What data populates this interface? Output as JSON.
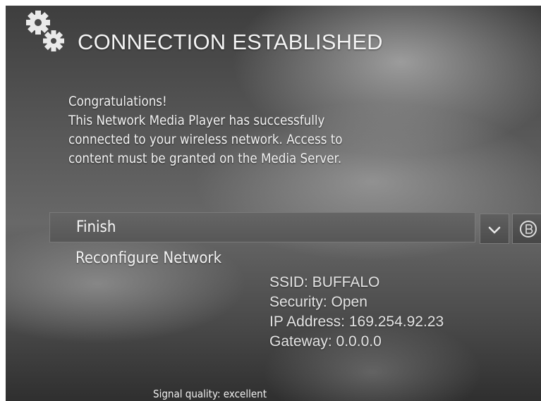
{
  "header": {
    "title": "CONNECTION ESTABLISHED",
    "icon": "gears-icon"
  },
  "message": {
    "lines": [
      "Congratulations!",
      "This Network Media Player has successfully",
      "connected to your wireless network. Access to",
      "content must be granted on the Media Server."
    ]
  },
  "menu": {
    "items": [
      {
        "label": "Finish",
        "selected": true
      },
      {
        "label": "Reconfigure Network",
        "selected": false
      }
    ],
    "select_icon": "checkmark-icon",
    "back_icon": "back-icon"
  },
  "network": {
    "ssid": "SSID: BUFFALO",
    "security": "Security: Open",
    "ip_address": "IP Address: 169.254.92.23",
    "gateway": "Gateway: 0.0.0.0"
  },
  "status": {
    "signal_quality": "Signal quality: excellent"
  }
}
